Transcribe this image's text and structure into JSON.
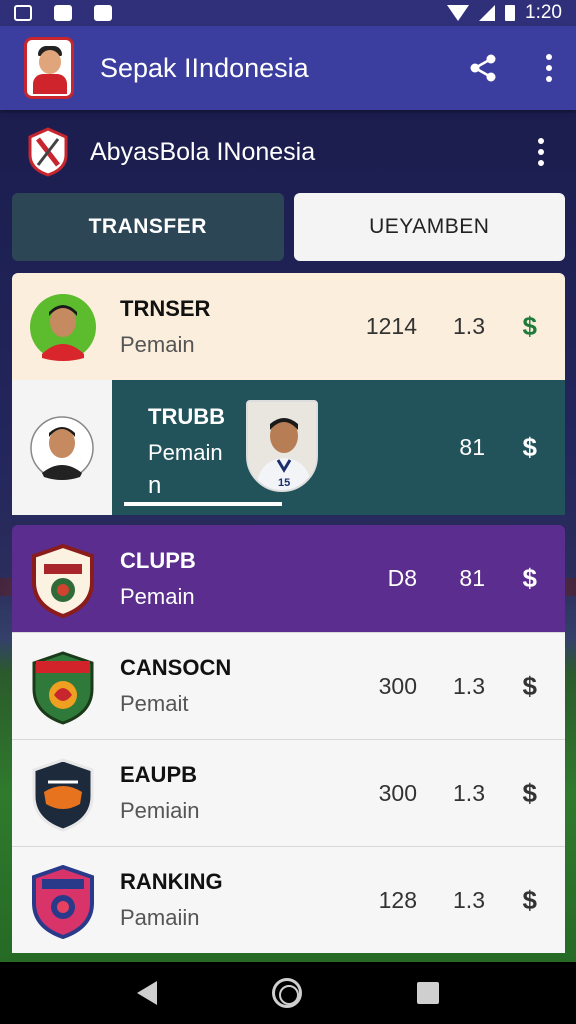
{
  "status_bar": {
    "time": "1:20"
  },
  "app_bar": {
    "title": "Sepak IIndonesia"
  },
  "sub_header": {
    "title": "AbyasBola INonesia"
  },
  "tabs": [
    {
      "label": "TRANSFER",
      "active": true
    },
    {
      "label": "UEYAMBEN",
      "active": false
    }
  ],
  "list": [
    {
      "name": "TRNSER",
      "role": "Pemain",
      "v1": "1214",
      "v2": "1.3",
      "currency": "$",
      "avatar": "player-avatar"
    },
    {
      "name": "TRUBB",
      "role": "Pemain",
      "extra": "n",
      "v1": "",
      "v2": "81",
      "currency": "$",
      "avatar": "player-avatar"
    },
    {
      "name": "CLUPB",
      "role": "Pemain",
      "v1": "D8",
      "v2": "81",
      "currency": "$",
      "avatar": "club-badge"
    },
    {
      "name": "CANSOCN",
      "role": "Pemait",
      "v1": "300",
      "v2": "1.3",
      "currency": "$",
      "avatar": "club-badge"
    },
    {
      "name": "EAUPB",
      "role": "Pemiain",
      "v1": "300",
      "v2": "1.3",
      "currency": "$",
      "avatar": "club-badge"
    },
    {
      "name": "RANKING",
      "role": "Pamaiin",
      "v1": "128",
      "v2": "1.3",
      "currency": "$",
      "avatar": "club-badge"
    }
  ],
  "colors": {
    "app_bar": "#3b3e9e",
    "tab_active": "#2c4656",
    "row_highlight": "#fbeedd",
    "row_teal": "#23535a",
    "row_purple": "#5a2d8e",
    "currency_green": "#1e7a3a"
  },
  "icons": [
    "share-icon",
    "more-vert-icon",
    "back-icon",
    "home-icon",
    "recents-icon"
  ]
}
